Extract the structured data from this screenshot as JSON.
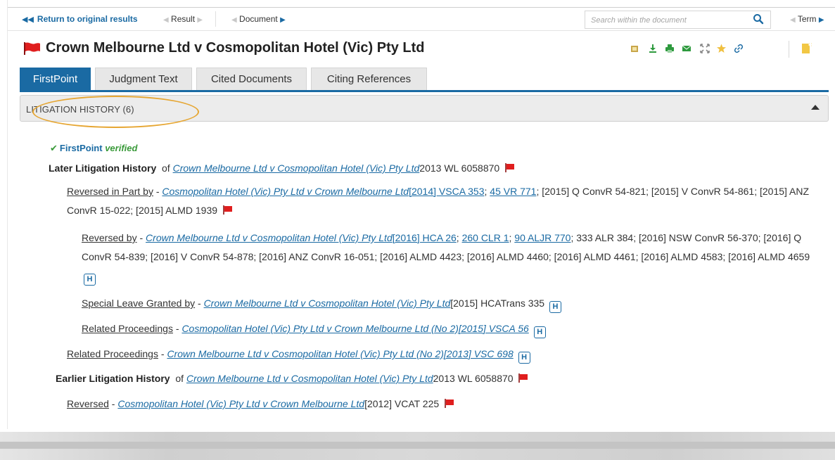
{
  "toolbar": {
    "return_label": "Return to original results",
    "result_label": "Result",
    "document_label": "Document",
    "search_placeholder": "Search within the document",
    "term_label": "Term"
  },
  "document": {
    "title": "Crown Melbourne Ltd v Cosmopolitan Hotel (Vic) Pty Ltd"
  },
  "action_icons": [
    "folder-icon",
    "download-icon",
    "print-icon",
    "email-icon",
    "fullscreen-icon",
    "star-icon",
    "link-icon",
    "note-icon"
  ],
  "tabs": [
    {
      "label": "FirstPoint",
      "active": true
    },
    {
      "label": "Judgment Text",
      "active": false
    },
    {
      "label": "Cited Documents",
      "active": false
    },
    {
      "label": "Citing References",
      "active": false
    }
  ],
  "section": {
    "title": "LITIGATION HISTORY (6)",
    "verified_prefix": "FirstPoint",
    "verified_word": "verified"
  },
  "later": {
    "label": "Later Litigation History",
    "of": "of",
    "case_link": "Crown Melbourne Ltd v Cosmopolitan Hotel (Vic) Pty Ltd",
    "citation": "2013 WL 6058870"
  },
  "entry1": {
    "relation": "Reversed in Part by",
    "dash": " - ",
    "case_link": "Cosmopolitan Hotel (Vic) Pty Ltd v Crown Melbourne Ltd",
    "cite_link1": "[2014] VSCA 353",
    "sep": "; ",
    "cite_link2": "45 VR 771",
    "rest": "; [2015] Q ConvR 54-821; [2015] V ConvR 54-861; [2015] ANZ ConvR 15-022; [2015] ALMD 1939"
  },
  "entry2": {
    "relation": "Reversed by",
    "dash": " - ",
    "case_link": "Crown Melbourne Ltd v Cosmopolitan Hotel (Vic) Pty Ltd",
    "cite_link1": "[2016] HCA 26",
    "sep": "; ",
    "cite_link2": "260 CLR 1",
    "cite_link3": "90 ALJR 770",
    "rest": "; 333 ALR 384; [2016] NSW ConvR 56-370; [2016] Q ConvR 54-839; [2016] V ConvR 54-878; [2016] ANZ ConvR 16-051; [2016] ALMD 4423; [2016] ALMD 4460; [2016] ALMD 4461; [2016] ALMD 4583; [2016] ALMD 4659",
    "badge": "H"
  },
  "entry3": {
    "relation": "Special Leave Granted by",
    "dash": " - ",
    "case_link": "Crown Melbourne Ltd v Cosmopolitan Hotel (Vic) Pty Ltd",
    "rest": "[2015] HCATrans 335",
    "badge": "H"
  },
  "entry4": {
    "relation": "Related Proceedings",
    "dash": " - ",
    "case_link": "Cosmopolitan Hotel (Vic) Pty Ltd v Crown Melbourne Ltd (No 2)[2015] VSCA 56",
    "badge": "H"
  },
  "entry5": {
    "relation": "Related Proceedings",
    "dash": " - ",
    "case_link": "Crown Melbourne Ltd v Cosmopolitan Hotel (Vic) Pty Ltd (No 2)[2013] VSC 698",
    "badge": "H"
  },
  "earlier": {
    "label": "Earlier Litigation History",
    "of": "of",
    "case_link": "Crown Melbourne Ltd v Cosmopolitan Hotel (Vic) Pty Ltd",
    "citation": "2013 WL 6058870"
  },
  "entry6": {
    "relation": "Reversed",
    "dash": " - ",
    "case_link": "Cosmopolitan Hotel (Vic) Pty Ltd v Crown Melbourne Ltd",
    "rest": "[2012] VCAT 225"
  },
  "colors": {
    "accent": "#1a6aa3",
    "flag_red": "#e01e1e",
    "verified_green": "#3a9a3a",
    "highlight": "#e6a632"
  }
}
